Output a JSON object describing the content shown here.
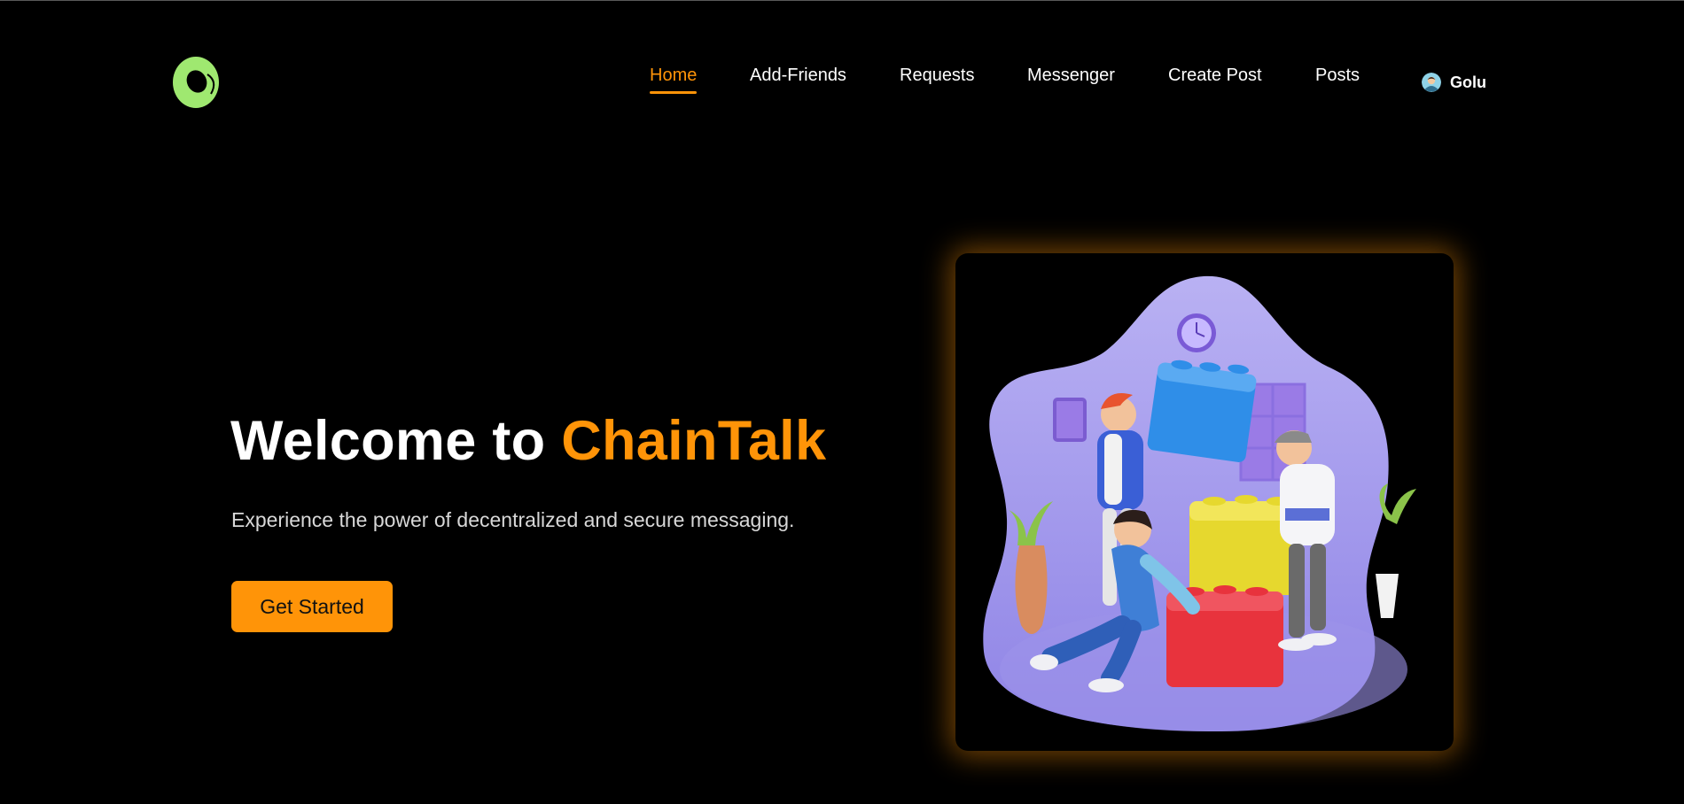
{
  "brand": {
    "logo_icon": "green-ring-logo-icon",
    "accent": "#ff9408",
    "logo_color": "#9fe870"
  },
  "nav": {
    "items": [
      {
        "label": "Home",
        "active": true
      },
      {
        "label": "Add-Friends",
        "active": false
      },
      {
        "label": "Requests",
        "active": false
      },
      {
        "label": "Messenger",
        "active": false
      },
      {
        "label": "Create Post",
        "active": false
      },
      {
        "label": "Posts",
        "active": false
      }
    ]
  },
  "user": {
    "name": "Golu",
    "avatar_icon": "user-avatar-icon"
  },
  "hero": {
    "title_prefix": "Welcome to ",
    "title_brand": "ChainTalk",
    "subtitle": "Experience the power of decentralized and secure messaging.",
    "cta_label": "Get Started",
    "illustration": "team-building-blocks-illustration"
  }
}
